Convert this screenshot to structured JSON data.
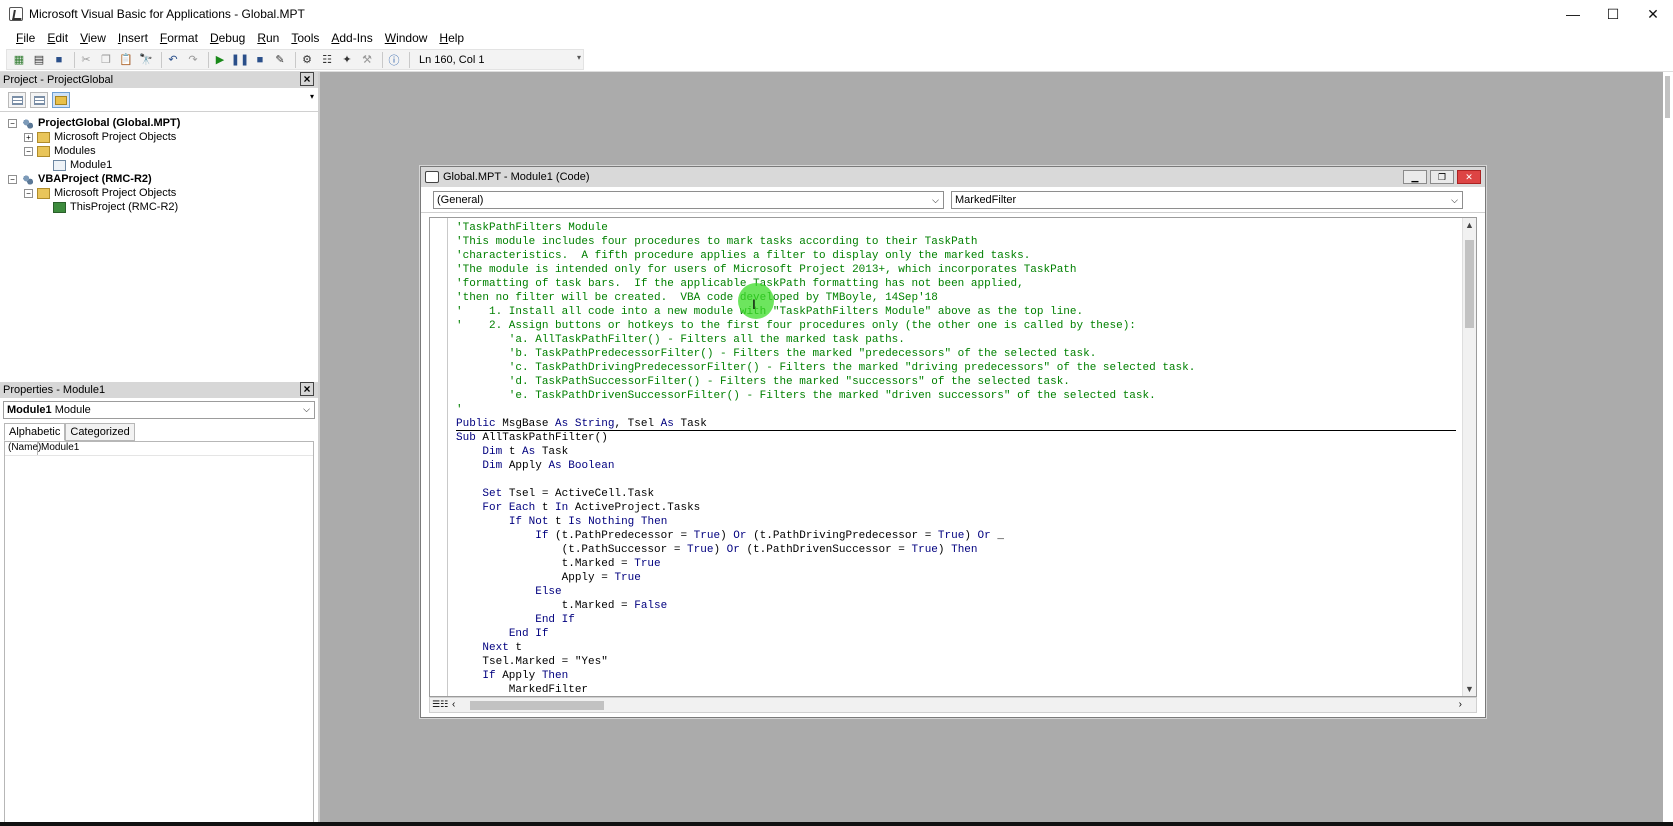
{
  "window": {
    "title": "Microsoft Visual Basic for Applications - Global.MPT",
    "controls": [
      "—",
      "☐",
      "✕"
    ]
  },
  "menu": [
    "File",
    "Edit",
    "View",
    "Insert",
    "Format",
    "Debug",
    "Run",
    "Tools",
    "Add-Ins",
    "Window",
    "Help"
  ],
  "toolbar": {
    "status": "Ln 160, Col 1",
    "icons": [
      "view-excel-icon",
      "insert-module-icon",
      "save-icon",
      "cut-icon",
      "copy-icon",
      "paste-icon",
      "find-icon",
      "undo-icon",
      "redo-icon",
      "run-icon",
      "break-icon",
      "reset-icon",
      "design-mode-icon",
      "project-explorer-icon",
      "properties-icon",
      "object-browser-icon",
      "toolbox-icon",
      "help-icon"
    ]
  },
  "project_panel": {
    "title": "Project - ProjectGlobal",
    "tree": [
      {
        "level": 0,
        "expander": "⊟",
        "icon": "proj",
        "label": "ProjectGlobal (Global.MPT)",
        "bold": true
      },
      {
        "level": 1,
        "expander": "⊞",
        "icon": "fold",
        "label": "Microsoft Project Objects",
        "bold": false
      },
      {
        "level": 1,
        "expander": "⊟",
        "icon": "fold",
        "label": "Modules",
        "bold": false
      },
      {
        "level": 2,
        "expander": "",
        "icon": "mod",
        "label": "Module1",
        "bold": false
      },
      {
        "level": 0,
        "expander": "⊟",
        "icon": "proj",
        "label": "VBAProject (RMC-R2)",
        "bold": true
      },
      {
        "level": 1,
        "expander": "⊟",
        "icon": "fold",
        "label": "Microsoft Project Objects",
        "bold": false
      },
      {
        "level": 2,
        "expander": "",
        "icon": "xl",
        "label": "ThisProject (RMC-R2)",
        "bold": false
      }
    ]
  },
  "properties_panel": {
    "title": "Properties - Module1",
    "selected_object": "Module1",
    "selected_type": "Module",
    "tabs": [
      "Alphabetic",
      "Categorized"
    ],
    "rows": [
      {
        "key": "(Name)",
        "value": "Module1"
      }
    ]
  },
  "code_window": {
    "title": "Global.MPT - Module1 (Code)",
    "object_combo": "(General)",
    "procedure_combo": "MarkedFilter",
    "lines": [
      {
        "t": "'TaskPathFilters Module",
        "c": "cmt"
      },
      {
        "t": "'This module includes four procedures to mark tasks according to their TaskPath",
        "c": "cmt"
      },
      {
        "t": "'characteristics.  A fifth procedure applies a filter to display only the marked tasks.",
        "c": "cmt"
      },
      {
        "t": "'The module is intended only for users of Microsoft Project 2013+, which incorporates TaskPath",
        "c": "cmt"
      },
      {
        "t": "'formatting of task bars.  If the applicable TaskPath formatting has not been applied,",
        "c": "cmt"
      },
      {
        "t": "'then no filter will be created.  VBA code developed by TMBoyle, 14Sep'18",
        "c": "cmt"
      },
      {
        "t": "'    1. Install all code into a new module with \"TaskPathFilters Module\" above as the top line.",
        "c": "cmt"
      },
      {
        "t": "'    2. Assign buttons or hotkeys to the first four procedures only (the other one is called by these):",
        "c": "cmt"
      },
      {
        "t": "        'a. AllTaskPathFilter() - Filters all the marked task paths.",
        "c": "cmt"
      },
      {
        "t": "        'b. TaskPathPredecessorFilter() - Filters the marked \"predecessors\" of the selected task.",
        "c": "cmt"
      },
      {
        "t": "        'c. TaskPathDrivingPredecessorFilter() - Filters the marked \"driving predecessors\" of the selected task.",
        "c": "cmt"
      },
      {
        "t": "        'd. TaskPathSuccessorFilter() - Filters the marked \"successors\" of the selected task.",
        "c": "cmt"
      },
      {
        "t": "        'e. TaskPathDrivenSuccessorFilter() - Filters the marked \"driven successors\" of the selected task.",
        "c": "cmt"
      },
      {
        "t": "'",
        "c": "cmt"
      },
      {
        "t": "Public MsgBase As String, Tsel As Task",
        "c": "sep"
      },
      {
        "t": "Sub AllTaskPathFilter()",
        "c": ""
      },
      {
        "t": "    Dim t As Task",
        "c": ""
      },
      {
        "t": "    Dim Apply As Boolean",
        "c": ""
      },
      {
        "t": "",
        "c": ""
      },
      {
        "t": "    Set Tsel = ActiveCell.Task",
        "c": ""
      },
      {
        "t": "    For Each t In ActiveProject.Tasks",
        "c": ""
      },
      {
        "t": "        If Not t Is Nothing Then",
        "c": ""
      },
      {
        "t": "            If (t.PathPredecessor = True) Or (t.PathDrivingPredecessor = True) Or _",
        "c": ""
      },
      {
        "t": "                (t.PathSuccessor = True) Or (t.PathDrivenSuccessor = True) Then",
        "c": ""
      },
      {
        "t": "                t.Marked = True",
        "c": ""
      },
      {
        "t": "                Apply = True",
        "c": ""
      },
      {
        "t": "            Else",
        "c": ""
      },
      {
        "t": "                t.Marked = False",
        "c": ""
      },
      {
        "t": "            End If",
        "c": ""
      },
      {
        "t": "        End If",
        "c": ""
      },
      {
        "t": "    Next t",
        "c": ""
      },
      {
        "t": "    Tsel.Marked = \"Yes\"",
        "c": ""
      },
      {
        "t": "    If Apply Then",
        "c": ""
      },
      {
        "t": "        MarkedFilter",
        "c": ""
      }
    ]
  },
  "colors": {
    "comment": "#008000",
    "keyword": "#00007f",
    "background": "#ababab"
  }
}
